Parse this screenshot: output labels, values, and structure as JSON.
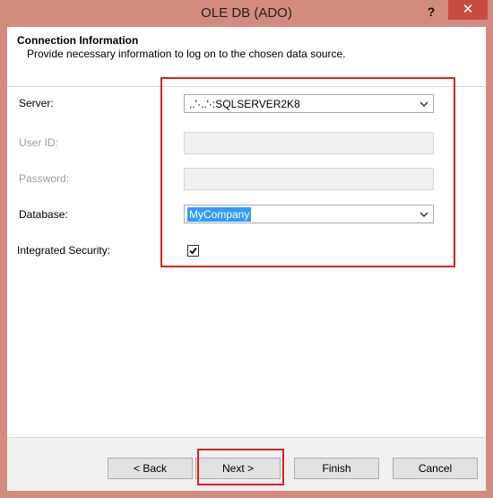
{
  "window": {
    "title": "OLE DB (ADO)",
    "help_label": "?",
    "close_label": "✕"
  },
  "header": {
    "title": "Connection Information",
    "subtitle": "Provide necessary information to log on to the chosen data source."
  },
  "form": {
    "server_label": "Server:",
    "server_value": "..'·..'·:SQLSERVER2K8",
    "user_id_label": "User ID:",
    "user_id_value": "",
    "password_label": "Password:",
    "password_value": "",
    "database_label": "Database:",
    "database_value": "MyCompany",
    "integrated_security_label": "Integrated Security:",
    "integrated_security_checked": true
  },
  "buttons": {
    "back": "< Back",
    "next": "Next >",
    "finish": "Finish",
    "cancel": "Cancel"
  },
  "colors": {
    "highlight": "#e02020",
    "selection": "#3399ff",
    "window_frame": "#d38b80"
  }
}
